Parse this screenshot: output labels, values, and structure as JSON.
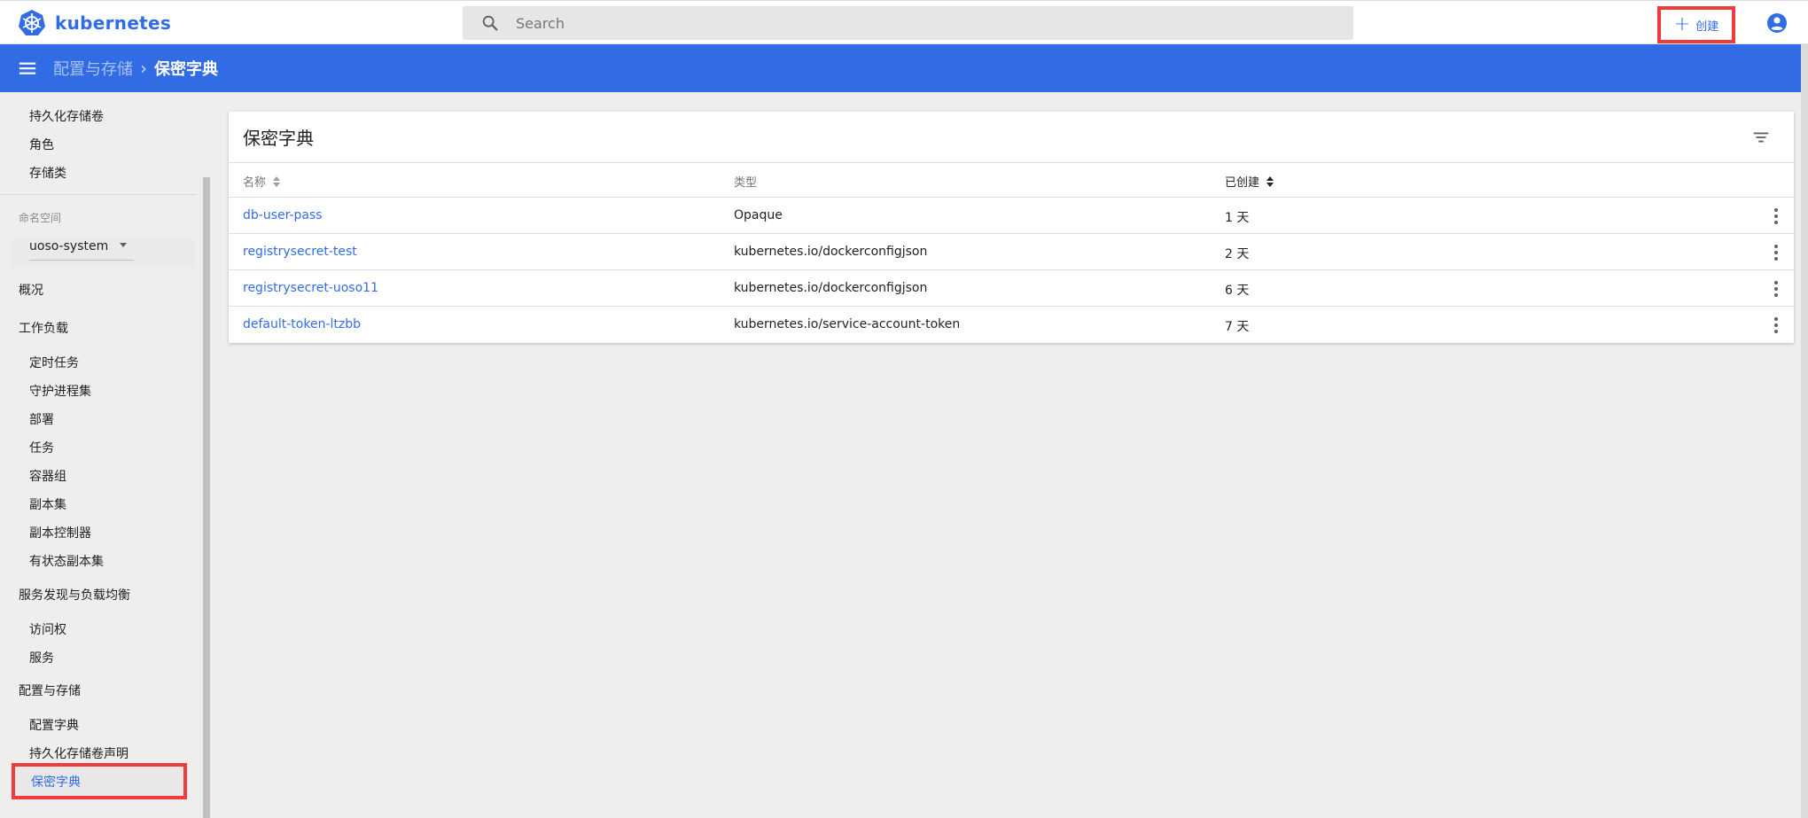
{
  "app": {
    "name": "kubernetes"
  },
  "search": {
    "placeholder": "Search"
  },
  "toolbar": {
    "create_label": "创建"
  },
  "breadcrumb": {
    "parent": "配置与存储",
    "separator": "›",
    "current": "保密字典"
  },
  "sidebar": {
    "top_items": [
      "持久化存储卷",
      "角色",
      "存储类"
    ],
    "namespace_label": "命名空间",
    "namespace_value": "uoso-system",
    "overview": "概况",
    "workloads_header": "工作负载",
    "workloads_items": [
      "定时任务",
      "守护进程集",
      "部署",
      "任务",
      "容器组",
      "副本集",
      "副本控制器",
      "有状态副本集"
    ],
    "discovery_header": "服务发现与负载均衡",
    "discovery_items": [
      "访问权",
      "服务"
    ],
    "config_header": "配置与存储",
    "config_items": [
      "配置字典",
      "持久化存储卷声明"
    ],
    "active_item": "保密字典"
  },
  "card": {
    "title": "保密字典",
    "columns": {
      "name": "名称",
      "type": "类型",
      "created": "已创建"
    },
    "rows": [
      {
        "name": "db-user-pass",
        "type": "Opaque",
        "created": "1 天"
      },
      {
        "name": "registrysecret-test",
        "type": "kubernetes.io/dockerconfigjson",
        "created": "2 天"
      },
      {
        "name": "registrysecret-uoso11",
        "type": "kubernetes.io/dockerconfigjson",
        "created": "6 天"
      },
      {
        "name": "default-token-ltzbb",
        "type": "kubernetes.io/service-account-token",
        "created": "7 天"
      }
    ]
  },
  "colors": {
    "brand": "#326ce5",
    "highlight": "#ef3b3b"
  }
}
